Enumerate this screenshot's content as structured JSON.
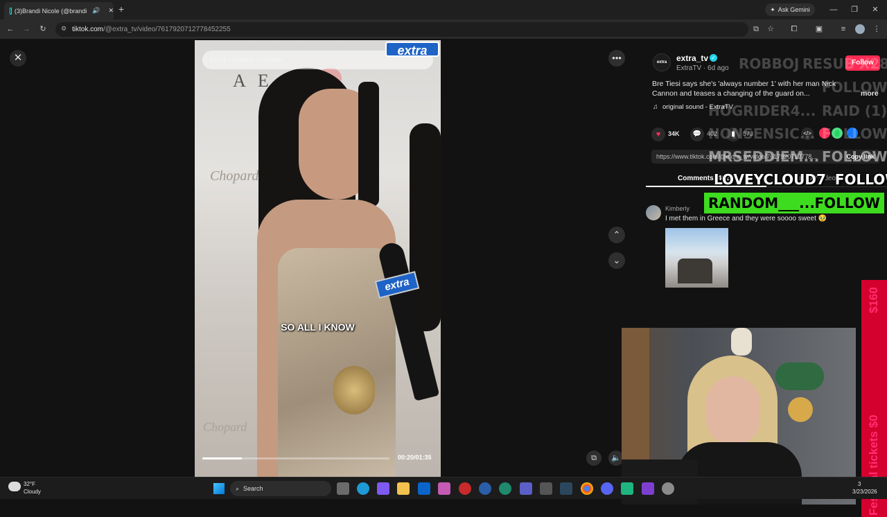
{
  "browser": {
    "tab_title": "(3)Brandi Nicole (@brandi",
    "new_tab_symbol": "+",
    "url_domain": "tiktok.com",
    "url_path": "/@extra_tv/video/7617920712778452255",
    "ask_gemini": "Ask Gemini",
    "window_controls": [
      "—",
      "❐",
      "✕"
    ]
  },
  "video": {
    "search_placeholder": "Find related content",
    "logo_text": "extra",
    "mic_logo_text": "extra",
    "caption": "SO ALL I KNOW",
    "timecode": "00:20/01:35",
    "progress_fraction": 0.21,
    "background_text": "A E",
    "background_brand": "Chopard"
  },
  "panel": {
    "account_name": "extra_tv",
    "account_sub": "ExtraTV · 6d ago",
    "avatar_text": "extra",
    "follow_label": "Follow",
    "description_line1": "Bre Tiesi says she's 'always number 1' with her man Nick",
    "description_line2": "Cannon and teases a changing of the guard on...",
    "more_label": "more",
    "sound": "original sound - ExtraTV",
    "likes": "34K",
    "comments_count": "402",
    "shares_count": "573",
    "link_url": "https://www.tiktok.com/@extra_tv/video/7617920712778...",
    "copy_link": "Copy link",
    "tab_comments": "Comments (402)",
    "tab_creator": "Creator videos",
    "comment_user": "Kimberly",
    "comment_text": "I met them in Greece and they were soooo sweet 🥹"
  },
  "overlay": {
    "row1_left": "ROBBOJ",
    "row1_right": "RESUB X28",
    "row2_right": "FOLLOW",
    "row3_left": "HOGRIDER4...",
    "row3_right": "RAID (1)",
    "row4_left": "NONSENSIC...",
    "row4_right": "FOLLOW",
    "row5_left": "MRSEDDIEM...",
    "row5_right": "FOLLOW",
    "row6_left": "LOVEYCLOUD7",
    "row6_right": "FOLLOW",
    "row7_left": "RANDOM___...",
    "row7_right": "FOLLOW",
    "banner_amount": "$160",
    "banner_text": "Festival tickets $0"
  },
  "taskbar": {
    "weather_temp": "32°F",
    "weather_desc": "Cloudy",
    "search_label": "Search",
    "clock_time": "3",
    "clock_date": "3/23/2026"
  },
  "colors": {
    "tiktok_red": "#fe2c55",
    "overlay_green": "#3ddc1f",
    "banner_red": "#d4002e",
    "extra_blue": "#1e63c6"
  }
}
